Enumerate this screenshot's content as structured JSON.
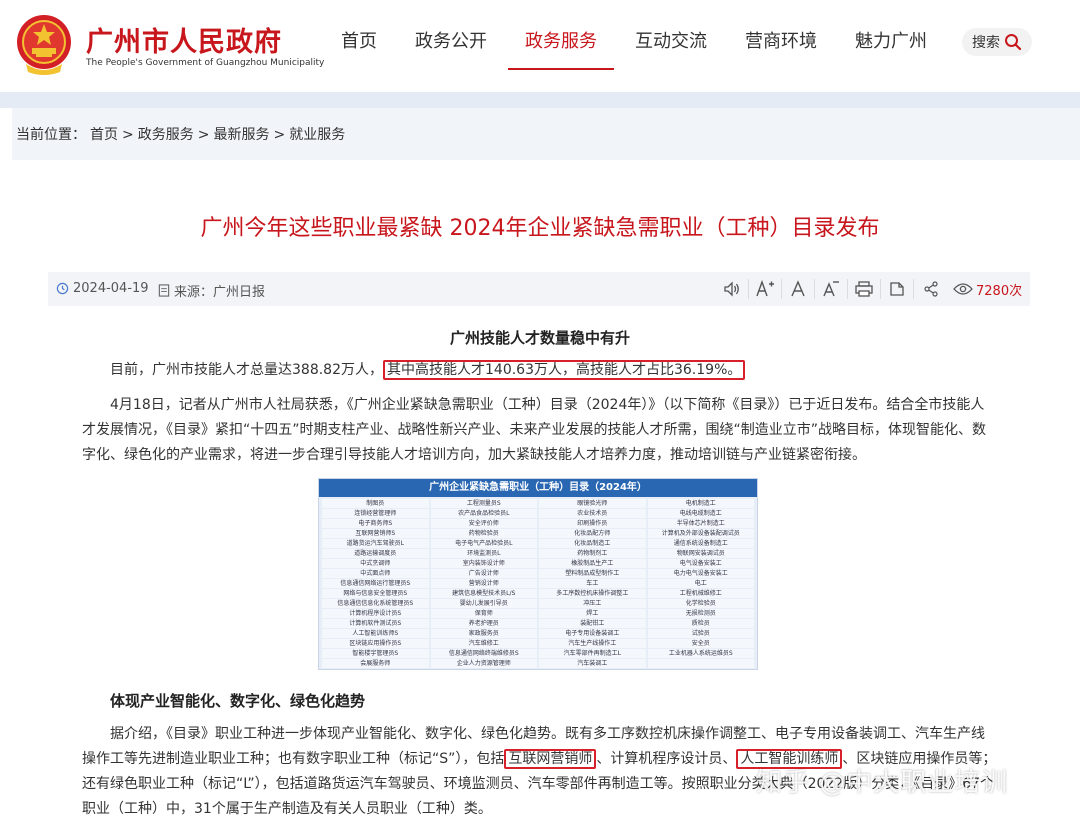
{
  "header": {
    "site_title": "广州市人民政府",
    "site_subtitle": "The People's Government of Guangzhou Municipality",
    "nav": [
      "首页",
      "政务公开",
      "政务服务",
      "互动交流",
      "营商环境",
      "魅力广州"
    ],
    "active_nav": "政务服务",
    "search_label": "搜索",
    "brand_color": "#c8161d"
  },
  "breadcrumb": {
    "prefix": "当前位置：",
    "items": [
      "首页",
      "政务服务",
      "最新服务",
      "就业服务"
    ],
    "sep": ">"
  },
  "article": {
    "title": "广州今年这些职业最紧缺 2024年企业紧缺急需职业（工种）目录发布",
    "date": "2024-04-19",
    "source": "来源：广州日报",
    "views": "7280次",
    "tools": [
      "speaker-icon",
      "font-increase-icon",
      "font-normal-icon",
      "font-decrease-icon",
      "print-icon",
      "bookmark-icon",
      "share-icon"
    ],
    "section1_title": "广州技能人才数量稳中有升",
    "p1_a": "目前，广州市技能人才总量达388.82万人，",
    "p1_hl": "其中高技能人才140.63万人，高技能人才占比36.19%。",
    "p2": "4月18日，记者从广州市人社局获悉，《广州企业紧缺急需职业（工种）目录（2024年）》（以下简称《目录》）已于近日发布。结合全市技能人才发展情况，《目录》紧扣“十四五”时期支柱产业、战略性新兴产业、未来产业发展的技能人才所需，围绕“制造业立市”战略目标，体现智能化、数字化、绿色化的产业需求，将进一步合理引导技能人才培训方向，加大紧缺技能人才培养力度，推动培训链与产业链紧密衔接。",
    "table_title": "广州企业紧缺急需职业（工种）目录（2024年）",
    "table_cells": [
      "制图员",
      "工程测量员S",
      "眼镜验光师",
      "电机制造工",
      "连锁经营管理师",
      "农产品食品检验员L",
      "农业技术员",
      "电线电缆制造工",
      "电子商务师S",
      "安全评价师",
      "印刷操作员",
      "半导体芯片制造工",
      "互联网营销师S",
      "药物检验员",
      "化妆品配方师",
      "计算机及外部设备装配调试员",
      "道路货运汽车驾驶员L",
      "电子电气产品检验员L",
      "化妆品制造工",
      "通信系统设备制造工",
      "道路运输调度员",
      "环境监测员L",
      "药物制剂工",
      "物联网安装调试员",
      "中式烹调师",
      "室内装饰设计师",
      "橡胶制品生产工",
      "电气设备安装工",
      "中式面点师",
      "广告设计师",
      "塑料制品成型制作工",
      "电力电气设备安装工",
      "信息通信网络运行管理员S",
      "营销设计师",
      "车工",
      "电工",
      "网络与信息安全管理员S",
      "建筑信息模型技术员L/S",
      "多工序数控机床操作调整工",
      "工程机械维修工",
      "信息通信信息化系统管理员S",
      "婴幼儿发展引导员",
      "冲压工",
      "化学检验员",
      "计算机程序设计员S",
      "保育师",
      "焊工",
      "无损检测员",
      "计算机软件测试员S",
      "养老护理员",
      "装配钳工",
      "质检员",
      "人工智能训练师S",
      "家政服务员",
      "电子专用设备装调工",
      "试验员",
      "区块链应用操作员S",
      "汽车维修工",
      "汽车生产线操作工",
      "安全员",
      "智能楼宇管理员S",
      "信息通信网络终端维修员S",
      "汽车零部件再制造工L",
      "工业机器人系统运维员S",
      "会展服务师",
      "企业人力资源管理师",
      "汽车装调工",
      ""
    ],
    "section2_title": "体现产业智能化、数字化、绿色化趋势",
    "p3_a": "据介绍，《目录》职业工种进一步体现产业智能化、数字化、绿色化趋势。既有多工序数控机床操作调整工、电子专用设备装调工、汽车生产线操作工等先进制造业职业工种；也有数字职业工种（标记“S”），包括",
    "p3_hl1": "互联网营销师",
    "p3_b": "、计算机程序设计员、",
    "p3_hl2": "人工智能训练师",
    "p3_c": "、区块链应用操作员等；还有绿色职业工种（标记“L”），包括道路货运汽车驾驶员、环境监测员、汽车零部件再制造工等。按照职业分类大典（2022版）分类，《目录》67个职业（工种）中，31个属于生产制造及有关人员职业（工种）类。"
  },
  "watermark": "知乎 @中大职业培训"
}
